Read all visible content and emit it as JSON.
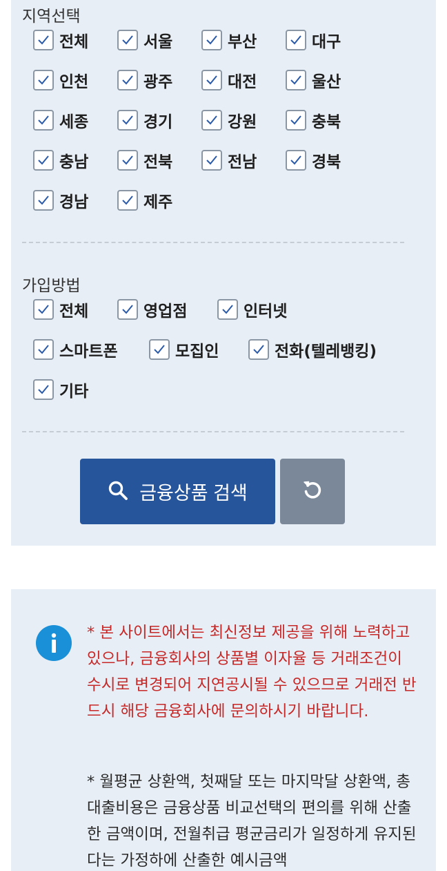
{
  "region": {
    "title": "지역선택",
    "options": [
      "전체",
      "서울",
      "부산",
      "대구",
      "인천",
      "광주",
      "대전",
      "울산",
      "세종",
      "경기",
      "강원",
      "충북",
      "충남",
      "전북",
      "전남",
      "경북",
      "경남",
      "제주"
    ]
  },
  "join_method": {
    "title": "가입방법",
    "options": [
      "전체",
      "영업점",
      "인터넷",
      "스마트폰",
      "모집인",
      "전화(텔레뱅킹)",
      "기타"
    ]
  },
  "actions": {
    "search_label": "금융상품 검색"
  },
  "notice": {
    "red": "* 본 사이트에서는 최신정보 제공을 위해 노력하고 있으나, 금융회사의 상품별 이자율 등 거래조건이 수시로 변경되어 지연공시될 수 있으므로 거래전 반드시 해당 금융회사에 문의하시기 바랍니다.",
    "black": "* 월평균 상환액, 첫째달 또는 마지막달 상환액, 총대출비용은 금융상품 비교선택의 편의를 위해 산출한 금액이며, 전월취급 평균금리가 일정하게 유지된다는 가정하에 산출한 예시금액"
  },
  "colors": {
    "panel_bg": "#e8eef5",
    "primary": "#27559c",
    "reset": "#7a8899",
    "notice_red": "#c62828",
    "info": "#1a90d8"
  }
}
